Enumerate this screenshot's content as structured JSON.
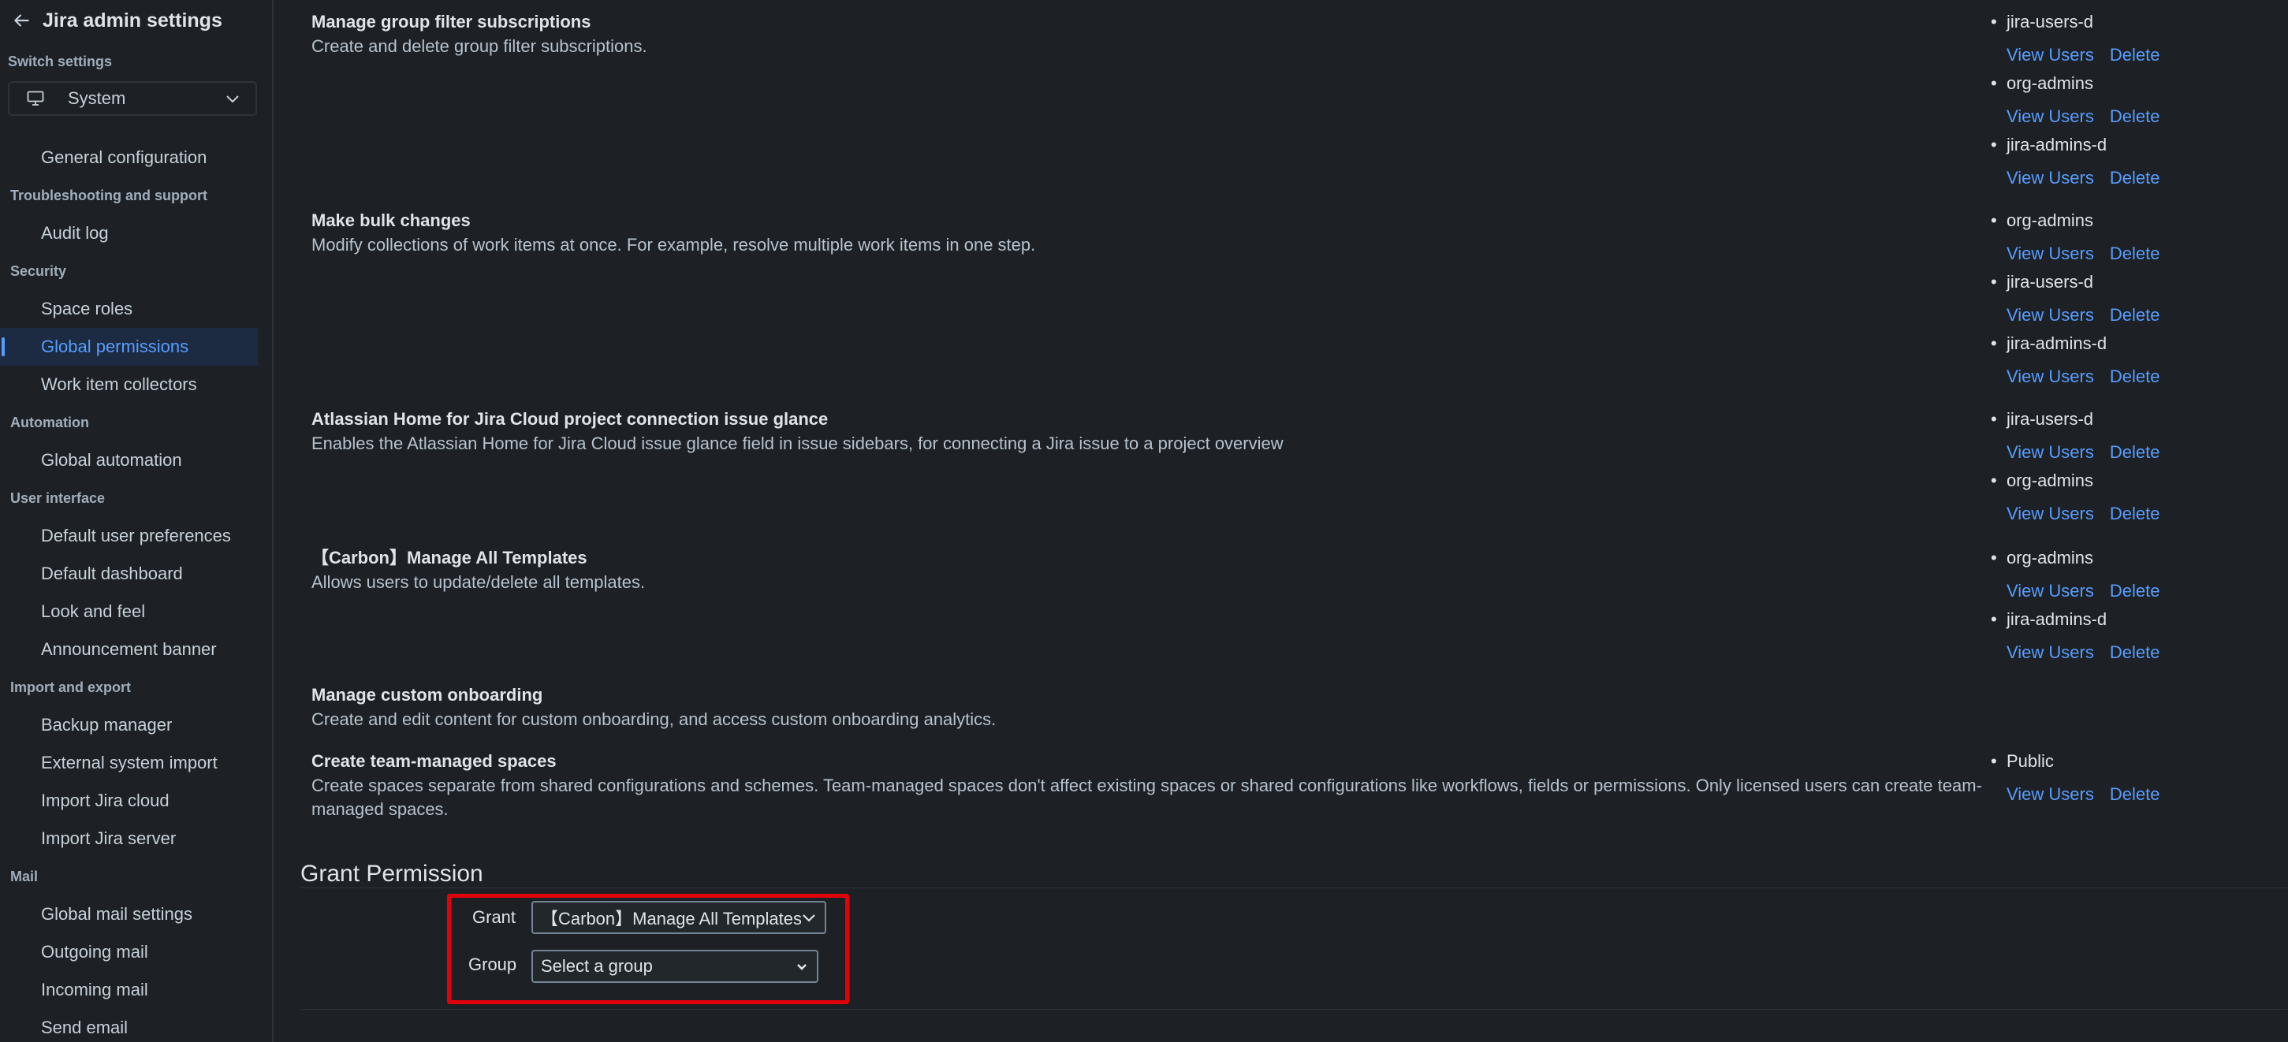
{
  "sidebar": {
    "title": "Jira admin settings",
    "switch_label": "Switch settings",
    "switch_value": "System",
    "nav": [
      {
        "type": "item",
        "label": "General configuration",
        "name": "general-configuration"
      },
      {
        "type": "section",
        "label": "Troubleshooting and support"
      },
      {
        "type": "item",
        "label": "Audit log",
        "name": "audit-log"
      },
      {
        "type": "section",
        "label": "Security"
      },
      {
        "type": "item",
        "label": "Space roles",
        "name": "space-roles"
      },
      {
        "type": "item",
        "label": "Global permissions",
        "name": "global-permissions",
        "active": true
      },
      {
        "type": "item",
        "label": "Work item collectors",
        "name": "work-item-collectors"
      },
      {
        "type": "section",
        "label": "Automation"
      },
      {
        "type": "item",
        "label": "Global automation",
        "name": "global-automation"
      },
      {
        "type": "section",
        "label": "User interface"
      },
      {
        "type": "item",
        "label": "Default user preferences",
        "name": "default-user-preferences"
      },
      {
        "type": "item",
        "label": "Default dashboard",
        "name": "default-dashboard"
      },
      {
        "type": "item",
        "label": "Look and feel",
        "name": "look-and-feel"
      },
      {
        "type": "item",
        "label": "Announcement banner",
        "name": "announcement-banner"
      },
      {
        "type": "section",
        "label": "Import and export"
      },
      {
        "type": "item",
        "label": "Backup manager",
        "name": "backup-manager"
      },
      {
        "type": "item",
        "label": "External system import",
        "name": "external-system-import"
      },
      {
        "type": "item",
        "label": "Import Jira cloud",
        "name": "import-jira-cloud"
      },
      {
        "type": "item",
        "label": "Import Jira server",
        "name": "import-jira-server"
      },
      {
        "type": "section",
        "label": "Mail"
      },
      {
        "type": "item",
        "label": "Global mail settings",
        "name": "global-mail-settings"
      },
      {
        "type": "item",
        "label": "Outgoing mail",
        "name": "outgoing-mail"
      },
      {
        "type": "item",
        "label": "Incoming mail",
        "name": "incoming-mail"
      },
      {
        "type": "item",
        "label": "Send email",
        "name": "send-email"
      }
    ]
  },
  "links": {
    "view_users": "View Users",
    "delete": "Delete"
  },
  "permissions": [
    {
      "title": "Manage group filter subscriptions",
      "description": "Create and delete group filter subscriptions.",
      "groups": [
        "jira-users-d",
        "org-admins",
        "jira-admins-d"
      ]
    },
    {
      "title": "Make bulk changes",
      "description": "Modify collections of work items at once. For example, resolve multiple work items in one step.",
      "groups": [
        "org-admins",
        "jira-users-d",
        "jira-admins-d"
      ]
    },
    {
      "title": "Atlassian Home for Jira Cloud project connection issue glance",
      "description": "Enables the Atlassian Home for Jira Cloud issue glance field in issue sidebars, for connecting a Jira issue to a project overview",
      "groups": [
        "jira-users-d",
        "org-admins"
      ]
    },
    {
      "title": "【Carbon】Manage All Templates",
      "description": "Allows users to update/delete all templates.",
      "groups": [
        "org-admins",
        "jira-admins-d"
      ]
    },
    {
      "title": "Manage custom onboarding",
      "description": "Create and edit content for custom onboarding, and access custom onboarding analytics.",
      "groups": []
    },
    {
      "title": "Create team-managed spaces",
      "description": "Create spaces separate from shared configurations and schemes. Team-managed spaces don't affect existing spaces or shared configurations like workflows, fields or permissions. Only licensed users can create team-managed spaces.",
      "groups": [
        "Public"
      ]
    }
  ],
  "grant": {
    "heading": "Grant Permission",
    "grant_label": "Grant",
    "grant_value": "【Carbon】Manage All Templates",
    "group_label": "Group",
    "group_value": "Select a group"
  }
}
